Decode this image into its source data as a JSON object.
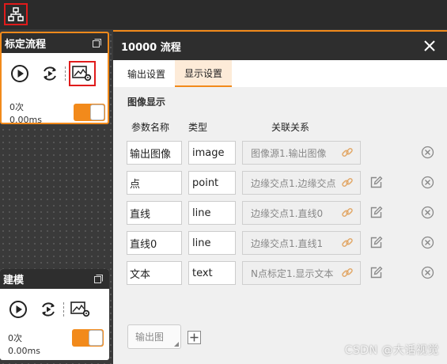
{
  "toolbar": {
    "flow_icon": "flowchart-icon"
  },
  "nodes": [
    {
      "title": "标定流程",
      "count": "0次",
      "time": "0.00ms"
    },
    {
      "title": "建模",
      "count": "0次",
      "time": "0.00ms"
    }
  ],
  "dialog": {
    "title": "10000 流程",
    "tabs": [
      {
        "label": "输出设置",
        "active": false
      },
      {
        "label": "显示设置",
        "active": true
      }
    ],
    "section_title": "图像显示",
    "columns": {
      "param": "参数名称",
      "type": "类型",
      "relation": "关联关系"
    },
    "rows": [
      {
        "name": "输出图像",
        "type": "image",
        "link": "图像源1.输出图像"
      },
      {
        "name": "点",
        "type": "point",
        "link": "边缘交点1.边缘交点"
      },
      {
        "name": "直线",
        "type": "line",
        "link": "边缘交点1.直线0"
      },
      {
        "name": "直线0",
        "type": "line",
        "link": "边缘交点1.直线1"
      },
      {
        "name": "文本",
        "type": "text",
        "link": "N点标定1.显示文本"
      }
    ],
    "add_output_label": "输出图"
  },
  "watermark": "CSDN @大话视觉",
  "colors": {
    "accent": "#f28a1b",
    "header_bg": "#2e2e2e",
    "highlight_border": "#e01b1b"
  }
}
